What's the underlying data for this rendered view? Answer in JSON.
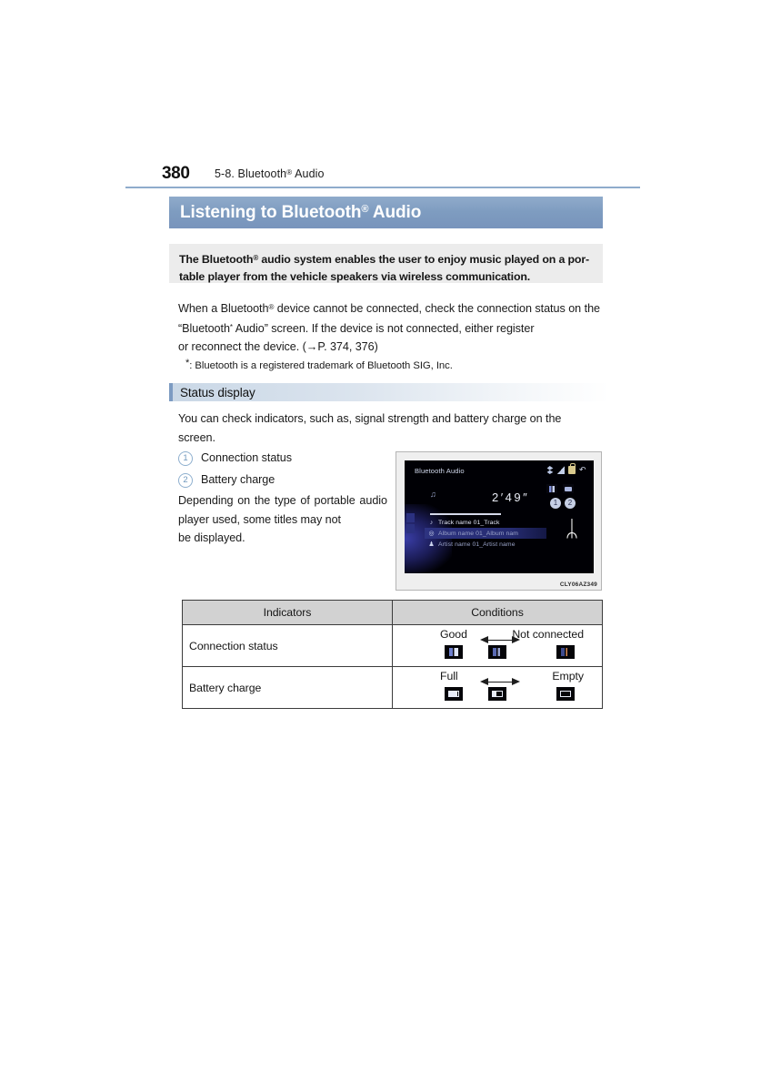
{
  "header": {
    "page_number": "380",
    "section_prefix": "5-8. Bluetooth",
    "section_sup": "®",
    "section_suffix": " Audio"
  },
  "title": {
    "prefix": "Listening to Bluetooth",
    "sup": "®",
    "suffix": " Audio"
  },
  "intro": {
    "line1_a": "The Bluetooth",
    "line1_sup": "®",
    "line1_b": " audio system enables the user to enjoy music played on a por-",
    "line2": "table player from the vehicle speakers via wireless communication."
  },
  "body": {
    "p1_a": "When a Bluetooth",
    "p1_sup": "®",
    "p1_b": " device cannot be connected, check the connection status on the “Bluetooth",
    "p1_star": "*",
    "p1_c": " Audio” screen. If the device is not connected, either register",
    "p1_last": "or reconnect the device. (→P. 374, 376)"
  },
  "footnote": {
    "star": "*",
    "text": ": Bluetooth is a registered trademark of Bluetooth SIG, Inc."
  },
  "status_section": {
    "heading": "Status display",
    "lead_line1": "You can check indicators, such as, signal strength and battery charge on the",
    "lead_line2": "screen.",
    "callouts": [
      {
        "marker": "1",
        "label": "Connection status"
      },
      {
        "marker": "2",
        "label": "Battery charge"
      }
    ],
    "note_line1": "Depending on the type of portable",
    "note_line2": "audio player used, some titles may not",
    "note_line3": "be displayed."
  },
  "figure": {
    "screen_title": "Bluetooth Audio",
    "music_note": "♫",
    "time": "2′49″",
    "big_bt_icon": "ᛦ",
    "callout_1": "1",
    "callout_2": "2",
    "rows": [
      {
        "icon": "♪",
        "text": "Track name 01_Track"
      },
      {
        "icon": "◎",
        "text": "Album name 01_Album nam"
      },
      {
        "icon": "♟",
        "text": "Artist name 01_Artist name"
      }
    ],
    "back_arrow": "↶",
    "code": "CLY06AZ349"
  },
  "table": {
    "headers": [
      "Indicators",
      "Conditions"
    ],
    "rows": [
      {
        "indicator": "Connection status",
        "left_label": "Good",
        "right_label": "Not connected",
        "icons": [
          "signal-good",
          "signal-medium",
          "signal-none"
        ]
      },
      {
        "indicator": "Battery charge",
        "left_label": "Full",
        "right_label": "Empty",
        "icons": [
          "battery-full",
          "battery-half",
          "battery-empty"
        ]
      }
    ]
  },
  "colors": {
    "title_bar": "#7E9CC0",
    "rule": "#8faccc",
    "intro_box": "#ececec",
    "table_header": "#d2d2d2",
    "accent": "#7C9BC2"
  }
}
